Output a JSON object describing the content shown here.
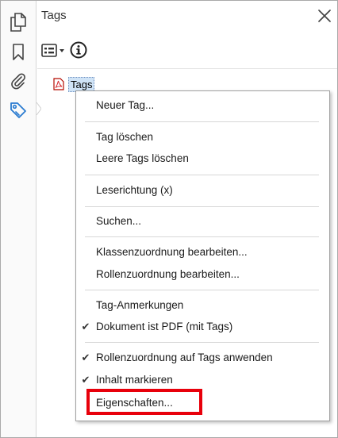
{
  "panel": {
    "title": "Tags"
  },
  "rail": {
    "icons": [
      "pages-icon",
      "bookmark-icon",
      "attachment-icon",
      "tag-icon"
    ]
  },
  "tree": {
    "root_label": "Tags"
  },
  "context_menu": {
    "items": [
      {
        "label": "Neuer Tag...",
        "checked": false
      },
      {
        "label": "Tag löschen",
        "checked": false
      },
      {
        "label": "Leere Tags löschen",
        "checked": false
      },
      {
        "label": "Leserichtung (x)",
        "checked": false
      },
      {
        "label": "Suchen...",
        "checked": false
      },
      {
        "label": "Klassenzuordnung bearbeiten...",
        "checked": false
      },
      {
        "label": "Rollenzuordnung bearbeiten...",
        "checked": false
      },
      {
        "label": "Tag-Anmerkungen",
        "checked": false
      },
      {
        "label": "Dokument ist PDF (mit Tags)",
        "checked": true
      },
      {
        "label": "Rollenzuordnung auf Tags anwenden",
        "checked": true
      },
      {
        "label": "Inhalt markieren",
        "checked": true
      },
      {
        "label": "Eigenschaften...",
        "checked": false
      }
    ],
    "check_glyph": "✔"
  },
  "colors": {
    "highlight_border": "#e8000b",
    "selection_bg": "#cfe3f6",
    "tag_icon_blue": "#2a7bd0"
  }
}
